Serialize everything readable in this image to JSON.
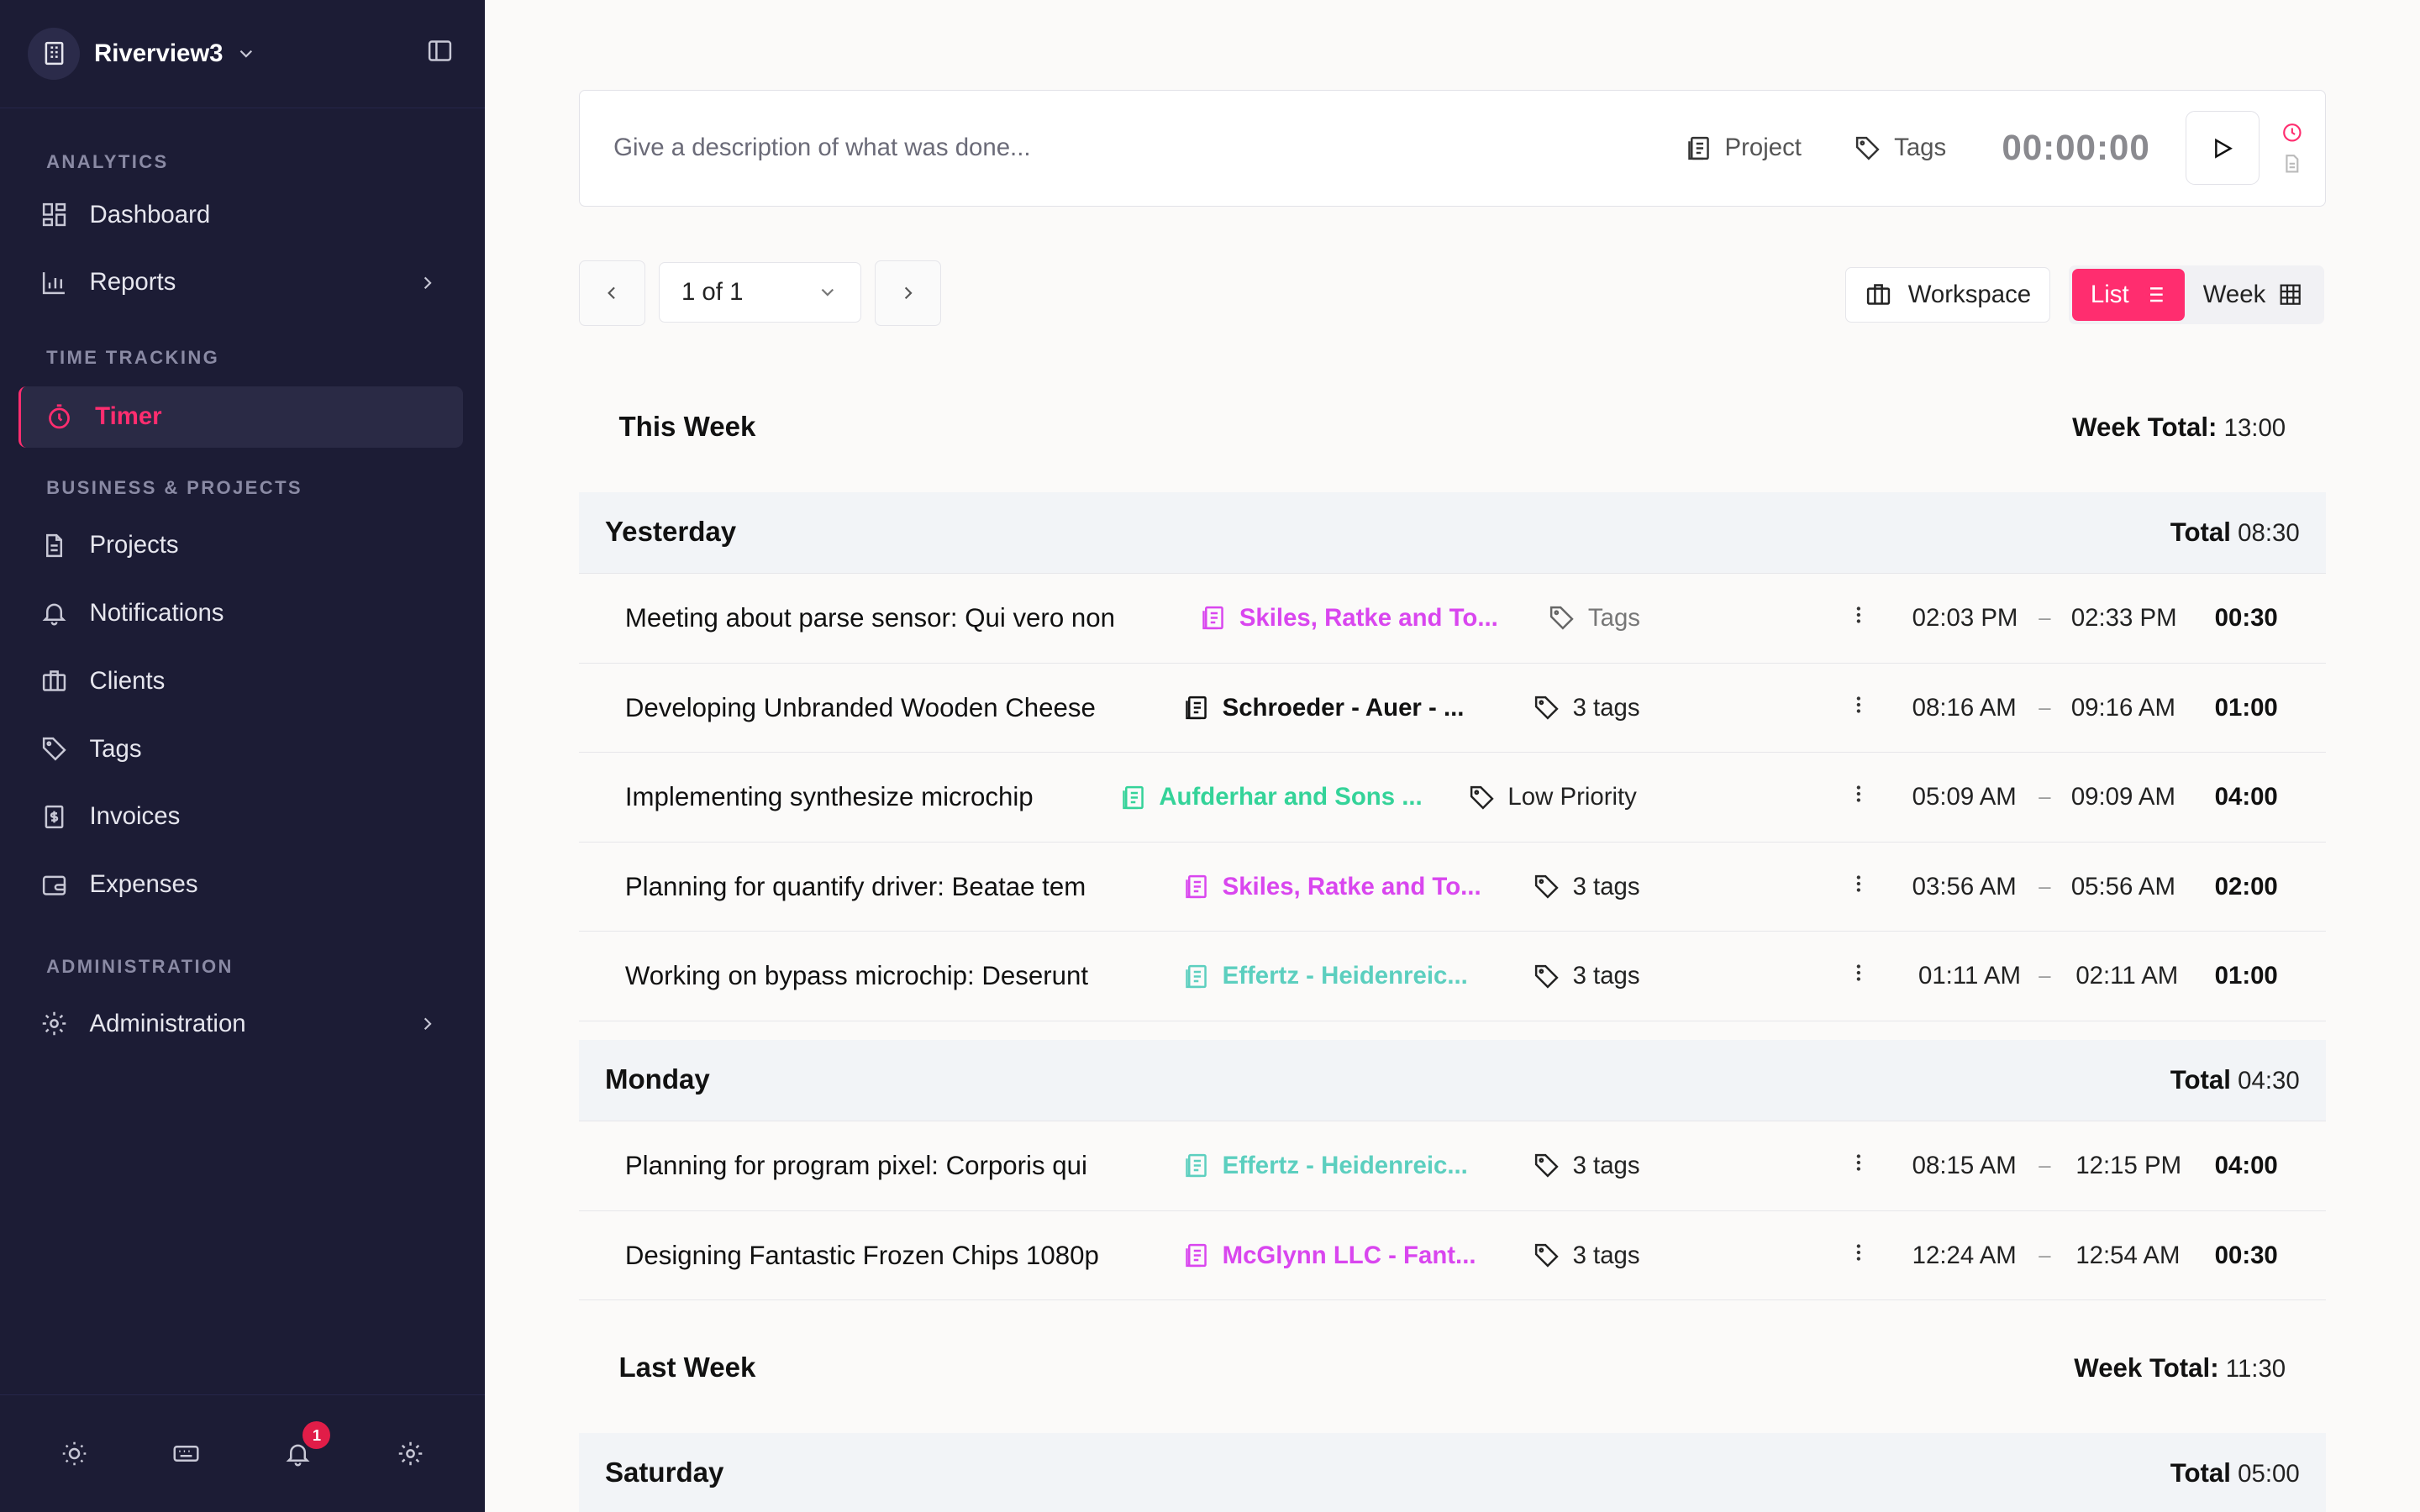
{
  "workspace": {
    "name": "Riverview3"
  },
  "sidebar": {
    "sections": [
      {
        "title": "ANALYTICS",
        "items": [
          {
            "label": "Dashboard"
          },
          {
            "label": "Reports"
          }
        ]
      },
      {
        "title": "TIME TRACKING",
        "items": [
          {
            "label": "Timer",
            "active": true
          }
        ]
      },
      {
        "title": "BUSINESS & PROJECTS",
        "items": [
          {
            "label": "Projects"
          },
          {
            "label": "Notifications"
          },
          {
            "label": "Clients"
          },
          {
            "label": "Tags"
          },
          {
            "label": "Invoices"
          },
          {
            "label": "Expenses"
          }
        ]
      },
      {
        "title": "ADMINISTRATION",
        "items": [
          {
            "label": "Administration"
          }
        ]
      }
    ],
    "notification_count": "1"
  },
  "timer": {
    "placeholder": "Give a description of what was done...",
    "project_label": "Project",
    "tags_label": "Tags",
    "time": "00:00:00"
  },
  "pager": {
    "label": "1 of 1"
  },
  "view": {
    "workspace_label": "Workspace",
    "list_label": "List",
    "week_label": "Week"
  },
  "colors": {
    "accent": "#ff2d6f",
    "sidebar_bg": "#1c1c35",
    "magenta_project": "#d946ef",
    "teal_project": "#5ccfbf",
    "green_project": "#34d399"
  },
  "weeks": [
    {
      "title": "This Week",
      "total_label": "Week Total:",
      "total": "13:00",
      "days": [
        {
          "name": "Yesterday",
          "total_label": "Total",
          "total": "08:30",
          "entries": [
            {
              "description": "Meeting about parse sensor: Qui vero non",
              "project": "Skiles, Ratke and To...",
              "project_color": "#d946ef",
              "tags": "Tags",
              "start": "02:03 PM",
              "end": "02:33 PM",
              "duration": "00:30"
            },
            {
              "description": "Developing Unbranded Wooden Cheese",
              "project": "Schroeder - Auer - ...",
              "project_color": "#111111",
              "tags": "3 tags",
              "start": "08:16 AM",
              "end": "09:16 AM",
              "duration": "01:00"
            },
            {
              "description": "Implementing synthesize microchip",
              "project": "Aufderhar and Sons ...",
              "project_color": "#34d399",
              "tags": "Low Priority",
              "start": "05:09 AM",
              "end": "09:09 AM",
              "duration": "04:00"
            },
            {
              "description": "Planning for quantify driver: Beatae tem",
              "project": "Skiles, Ratke and To...",
              "project_color": "#d946ef",
              "tags": "3 tags",
              "start": "03:56 AM",
              "end": "05:56 AM",
              "duration": "02:00"
            },
            {
              "description": "Working on bypass microchip: Deserunt",
              "project": "Effertz - Heidenreic...",
              "project_color": "#5ccfbf",
              "tags": "3 tags",
              "start": "01:11 AM",
              "end": "02:11 AM",
              "duration": "01:00"
            }
          ]
        },
        {
          "name": "Monday",
          "total_label": "Total",
          "total": "04:30",
          "entries": [
            {
              "description": "Planning for program pixel: Corporis qui",
              "project": "Effertz - Heidenreic...",
              "project_color": "#5ccfbf",
              "tags": "3 tags",
              "start": "08:15 AM",
              "end": "12:15 PM",
              "duration": "04:00"
            },
            {
              "description": "Designing Fantastic Frozen Chips 1080p",
              "project": "McGlynn LLC - Fant...",
              "project_color": "#d946ef",
              "tags": "3 tags",
              "start": "12:24 AM",
              "end": "12:54 AM",
              "duration": "00:30"
            }
          ]
        }
      ]
    },
    {
      "title": "Last Week",
      "total_label": "Week Total:",
      "total": "11:30",
      "days": [
        {
          "name": "Saturday",
          "total_label": "Total",
          "total": "05:00",
          "entries": []
        }
      ]
    }
  ]
}
